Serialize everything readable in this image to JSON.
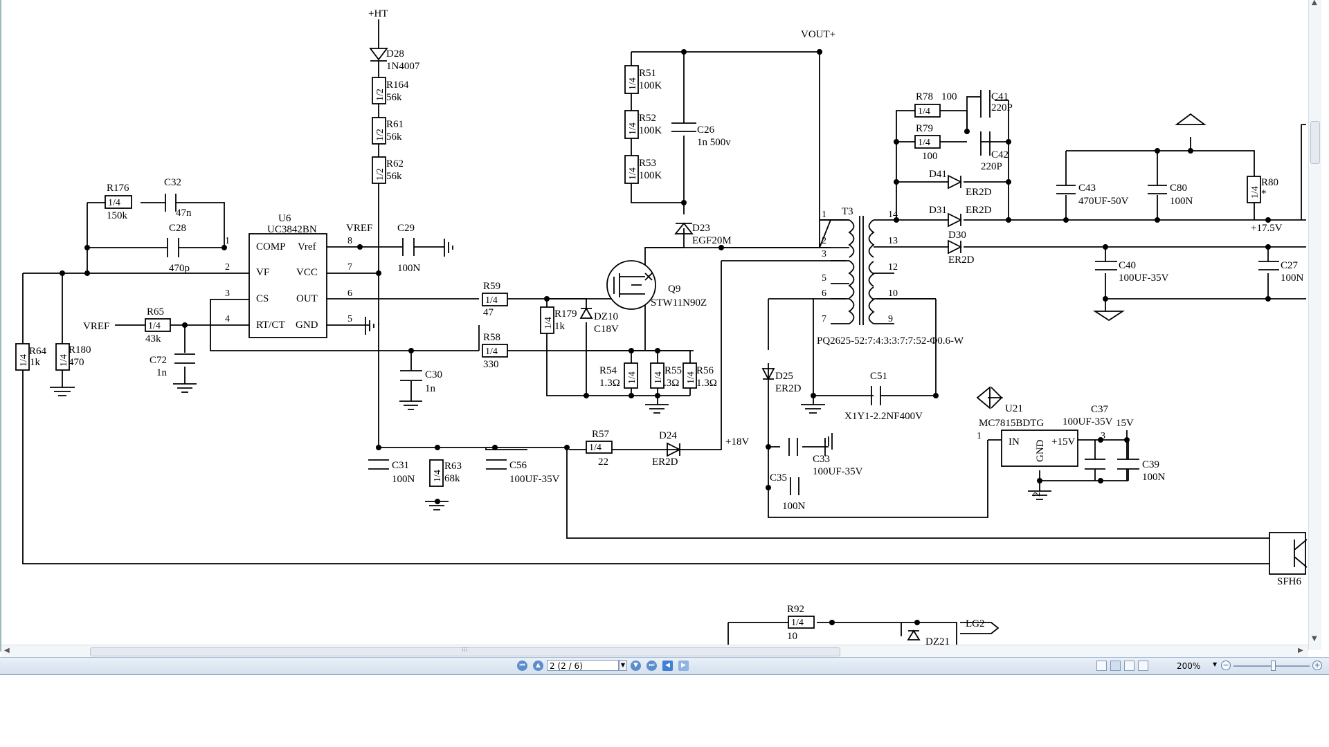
{
  "statusbar": {
    "page_value": "2 (2 / 6)",
    "zoom": "200%",
    "nav_icons": [
      "first-page-icon",
      "previous-page-icon",
      "next-page-icon",
      "last-page-icon",
      "back-icon",
      "forward-icon"
    ],
    "view_icons": [
      "single-page-icon",
      "continuous-icon",
      "facing-icon",
      "fit-icon"
    ]
  },
  "schematic": {
    "nets": {
      "ht": "+HT",
      "vout": "VOUT+",
      "vref_pin": "VREF",
      "vref_in": "VREF",
      "v18": "+18V",
      "v175": "+17.5V",
      "v15": "15V",
      "lg2": "LG2"
    },
    "u6": {
      "ref": "U6",
      "part": "UC3842BN",
      "comp": "COMP",
      "vf": "VF",
      "cs": "CS",
      "rtct": "RT/CT",
      "vref": "Vref",
      "vcc": "VCC",
      "out": "OUT",
      "gnd": "GND",
      "p1": "1",
      "p2": "2",
      "p3": "3",
      "p4": "4",
      "p5": "5",
      "p6": "6",
      "p7": "7",
      "p8": "8"
    },
    "resistors": [
      {
        "ref": "R176",
        "val": "150k",
        "rating": "1/4"
      },
      {
        "ref": "R65",
        "val": "43k",
        "rating": "1/4"
      },
      {
        "ref": "R64",
        "val": "1k",
        "rating": "1/4"
      },
      {
        "ref": "R180",
        "val": "470",
        "rating": "1/4"
      },
      {
        "ref": "R164",
        "val": "56k",
        "rating": "1/2"
      },
      {
        "ref": "R61",
        "val": "56k",
        "rating": "1/2"
      },
      {
        "ref": "R62",
        "val": "56k",
        "rating": "1/2"
      },
      {
        "ref": "R59",
        "val": "47",
        "rating": "1/4"
      },
      {
        "ref": "R58",
        "val": "330",
        "rating": "1/4"
      },
      {
        "ref": "R179",
        "val": "1k",
        "rating": "1/4"
      },
      {
        "ref": "R54",
        "val": "1.3Ω",
        "rating": "1/4"
      },
      {
        "ref": "R55",
        "val": ".3Ω",
        "rating": "1/4"
      },
      {
        "ref": "R56",
        "val": "1.3Ω",
        "rating": "1/4"
      },
      {
        "ref": "R51",
        "val": "100K",
        "rating": "1/4"
      },
      {
        "ref": "R52",
        "val": "100K",
        "rating": "1/4"
      },
      {
        "ref": "R53",
        "val": "100K",
        "rating": "1/4"
      },
      {
        "ref": "R57",
        "val": "22",
        "rating": "1/4"
      },
      {
        "ref": "R63",
        "val": "68k",
        "rating": "1/4"
      },
      {
        "ref": "R78",
        "val": "100",
        "rating": "1/4"
      },
      {
        "ref": "R79",
        "val": "100",
        "rating": "1/4"
      },
      {
        "ref": "R80",
        "val": "*",
        "rating": "1/4"
      },
      {
        "ref": "R92",
        "val": "10",
        "rating": "1/4"
      }
    ],
    "capacitors": [
      {
        "ref": "C32",
        "val": "47n"
      },
      {
        "ref": "C28",
        "val": "470p"
      },
      {
        "ref": "C29",
        "val": "100N"
      },
      {
        "ref": "C72",
        "val": "1n"
      },
      {
        "ref": "C30",
        "val": "1n"
      },
      {
        "ref": "C31",
        "val": "100N"
      },
      {
        "ref": "C56",
        "val": "100UF-35V"
      },
      {
        "ref": "C26",
        "val": "1n 500v"
      },
      {
        "ref": "C41",
        "val": "220P"
      },
      {
        "ref": "C42",
        "val": "220P"
      },
      {
        "ref": "C43",
        "val": "470UF-50V"
      },
      {
        "ref": "C80",
        "val": "100N"
      },
      {
        "ref": "C40",
        "val": "100UF-35V"
      },
      {
        "ref": "C27",
        "val": "100N"
      },
      {
        "ref": "C51",
        "val": "X1Y1-2.2NF400V"
      },
      {
        "ref": "C33",
        "val": "100UF-35V"
      },
      {
        "ref": "C35",
        "val": "100N"
      },
      {
        "ref": "C37",
        "val": "100UF-35V"
      },
      {
        "ref": "C39",
        "val": "100N"
      }
    ],
    "diodes": [
      {
        "ref": "D28",
        "val": "1N4007"
      },
      {
        "ref": "D23",
        "val": "EGF20M"
      },
      {
        "ref": "DZ10",
        "val": "C18V"
      },
      {
        "ref": "D24",
        "val": "ER2D"
      },
      {
        "ref": "D41",
        "val": "ER2D"
      },
      {
        "ref": "D31",
        "val": "ER2D"
      },
      {
        "ref": "D30",
        "val": "ER2D"
      },
      {
        "ref": "D25",
        "val": "ER2D"
      },
      {
        "ref": "DZ21",
        "val": ""
      }
    ],
    "q9": {
      "ref": "Q9",
      "part": "STW11N90Z"
    },
    "t3": {
      "ref": "T3",
      "spec": "PQ2625-52:7:4:3:3:7:7:52-Φ0.6-W",
      "pins": [
        "1",
        "2",
        "3",
        "5",
        "6",
        "7",
        "14",
        "13",
        "12",
        "10",
        "9"
      ]
    },
    "u21": {
      "ref": "U21",
      "part": "MC7815BDTG",
      "in": "IN",
      "gnd": "GND",
      "out": "+15V",
      "p1": "1",
      "p2": "2",
      "p3": "3"
    },
    "opto": {
      "ref": "SFH6"
    }
  }
}
